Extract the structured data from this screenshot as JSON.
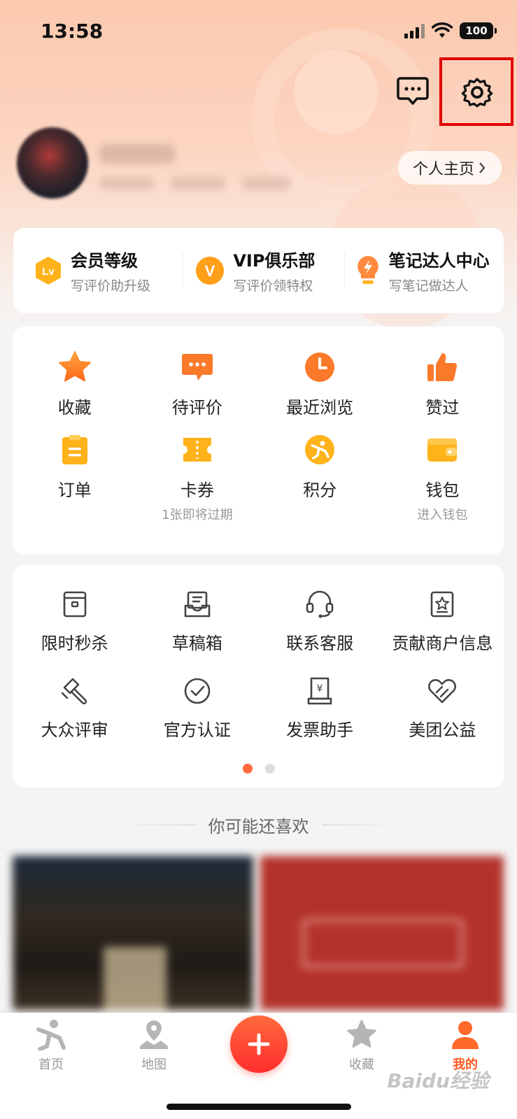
{
  "status_bar": {
    "time": "13:58",
    "battery": "100"
  },
  "header": {
    "profile_button_label": "个人主页"
  },
  "membership": [
    {
      "title": "会员等级",
      "subtitle": "写评价助升级",
      "icon": "level-badge-icon",
      "badge": "Lv"
    },
    {
      "title": "VIP俱乐部",
      "subtitle": "写评价领特权",
      "icon": "vip-badge-icon",
      "badge": "V"
    },
    {
      "title": "笔记达人中心",
      "subtitle": "写笔记做达人",
      "icon": "lightbulb-icon"
    }
  ],
  "services": [
    {
      "label": "收藏",
      "icon": "star-icon"
    },
    {
      "label": "待评价",
      "icon": "comment-icon"
    },
    {
      "label": "最近浏览",
      "icon": "clock-icon"
    },
    {
      "label": "赞过",
      "icon": "thumbs-up-icon"
    },
    {
      "label": "订单",
      "icon": "order-icon"
    },
    {
      "label": "卡券",
      "icon": "coupon-icon",
      "subtitle": "1张即将过期"
    },
    {
      "label": "积分",
      "icon": "points-icon"
    },
    {
      "label": "钱包",
      "icon": "wallet-icon",
      "subtitle": "进入钱包"
    }
  ],
  "tools": [
    {
      "label": "限时秒杀",
      "icon": "flash-sale-icon"
    },
    {
      "label": "草稿箱",
      "icon": "drafts-icon"
    },
    {
      "label": "联系客服",
      "icon": "headset-icon"
    },
    {
      "label": "贡献商户信息",
      "icon": "merchant-info-icon"
    },
    {
      "label": "大众评审",
      "icon": "gavel-icon"
    },
    {
      "label": "官方认证",
      "icon": "verified-icon"
    },
    {
      "label": "发票助手",
      "icon": "invoice-icon"
    },
    {
      "label": "美团公益",
      "icon": "charity-icon"
    }
  ],
  "tools_pager": {
    "pages": 2,
    "current": 1
  },
  "recommend": {
    "title": "你可能还喜欢"
  },
  "tabbar": {
    "tabs": [
      {
        "label": "首页",
        "icon": "home-icon"
      },
      {
        "label": "地图",
        "icon": "map-icon"
      },
      {
        "label": "",
        "icon": "add-icon"
      },
      {
        "label": "收藏",
        "icon": "favorites-icon"
      },
      {
        "label": "我的",
        "icon": "profile-icon",
        "active": true
      }
    ]
  },
  "watermark": "Baidu经验",
  "colors": {
    "accent": "#ff6a3d",
    "highlight": "#e30000",
    "tab_active": "#ff5a1f",
    "icon_orange": "#fb7a2a",
    "icon_yellow": "#ffb21a"
  }
}
